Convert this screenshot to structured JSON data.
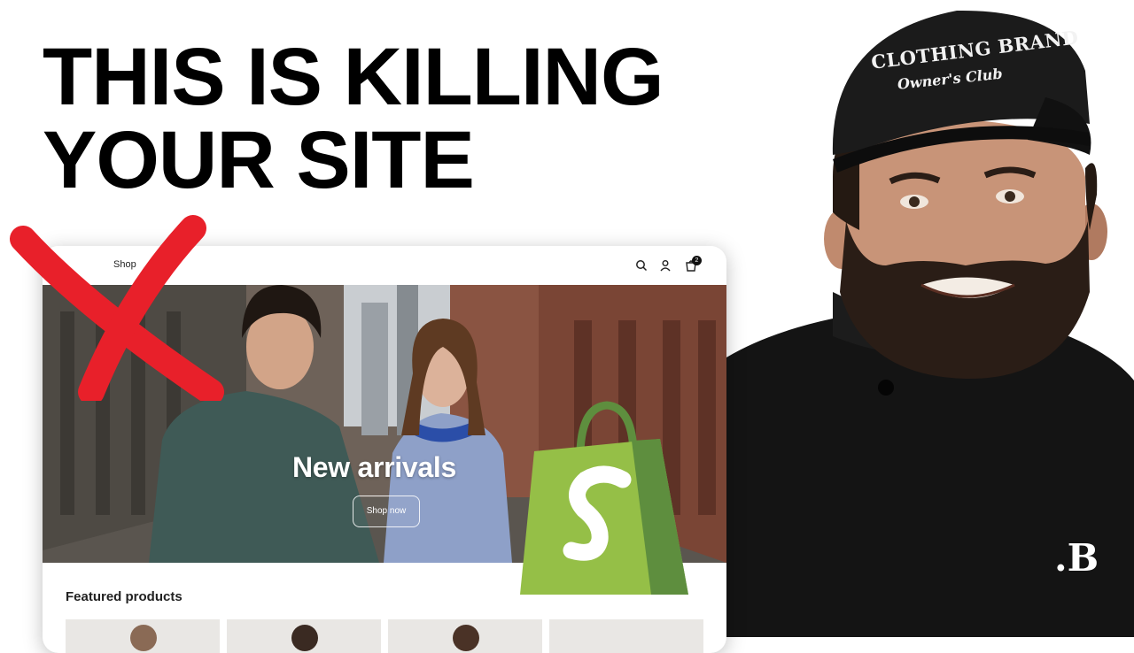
{
  "headline": {
    "line1": "THIS IS KILLING",
    "line2": "YOUR SITE"
  },
  "store": {
    "shop_name": "Shop",
    "cart_count": "2",
    "hero_title": "New arrivals",
    "hero_button": "Shop now",
    "featured_title": "Featured products",
    "header_icons": [
      "search-icon",
      "account-icon",
      "cart-icon"
    ]
  },
  "overlay": {
    "mark": "red-x-icon",
    "mark_color": "#e8202a",
    "logo": "shopify-logo",
    "logo_color": "#95bf47"
  },
  "host": {
    "hat_line1": "CLOTHING BRAND",
    "hat_line2": "Owner's Club",
    "shirt_mark": ".B"
  }
}
